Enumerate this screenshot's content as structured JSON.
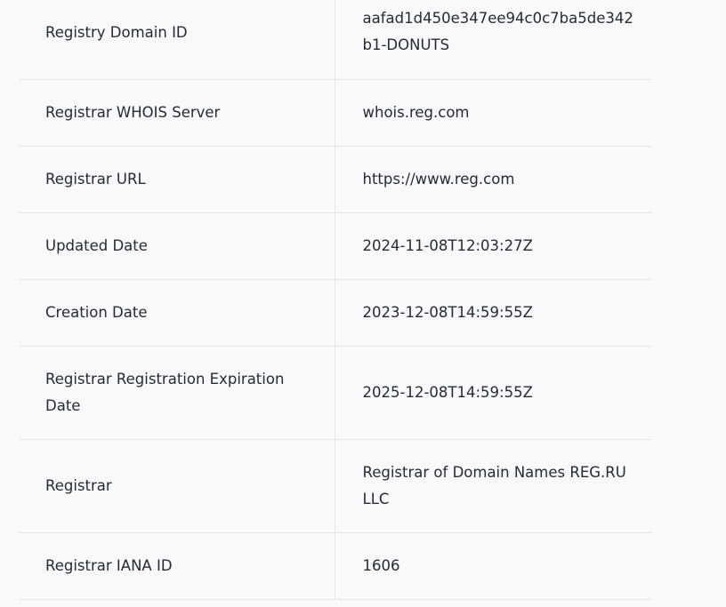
{
  "rows": [
    {
      "label": "Registry Domain ID",
      "value": "aafad1d450e347ee94c0c7ba5de342b1-DONUTS"
    },
    {
      "label": "Registrar WHOIS Server",
      "value": "whois.reg.com"
    },
    {
      "label": "Registrar URL",
      "value": "https://www.reg.com"
    },
    {
      "label": "Updated Date",
      "value": "2024-11-08T12:03:27Z"
    },
    {
      "label": "Creation Date",
      "value": "2023-12-08T14:59:55Z"
    },
    {
      "label": "Registrar Registration Expiration Date",
      "value": "2025-12-08T14:59:55Z"
    },
    {
      "label": "Registrar",
      "value": "Registrar of Domain Names REG.RU LLC"
    },
    {
      "label": "Registrar IANA ID",
      "value": "1606"
    }
  ]
}
